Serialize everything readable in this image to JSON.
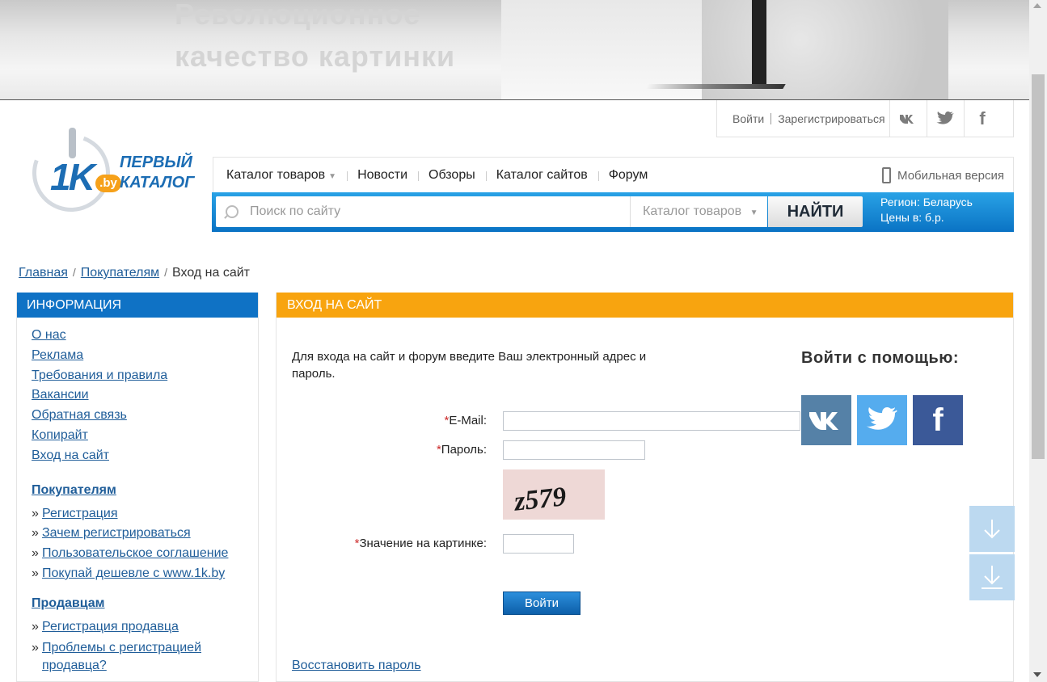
{
  "banner": {
    "headline_line1": "Революционное",
    "headline_line2": "качество картинки"
  },
  "userbar": {
    "login": "Войти",
    "register": "Зарегистрироваться",
    "social": [
      "vk-icon",
      "twitter-icon",
      "facebook-icon"
    ]
  },
  "logo": {
    "number": "1K",
    "domain": ".by",
    "word1": "ПЕРВЫЙ",
    "word2": "КАТАЛОГ"
  },
  "nav": {
    "items": [
      "Каталог товаров",
      "Новости",
      "Обзоры",
      "Каталог сайтов",
      "Форум"
    ],
    "mobile": "Мобильная версия"
  },
  "search": {
    "placeholder": "Поиск по сайту",
    "scope": "Каталог товаров",
    "button": "НАЙТИ",
    "region": "Регион: Беларусь",
    "currency": "Цены в: б.р."
  },
  "breadcrumb": {
    "home": "Главная",
    "section": "Покупателям",
    "current": "Вход на сайт"
  },
  "sidebar": {
    "header": "ИНФОРМАЦИЯ",
    "info_links": [
      "О нас",
      "Реклама",
      "Требования и правила",
      "Вакансии",
      "Обратная связь",
      "Копирайт",
      "Вход на сайт"
    ],
    "buyers_title": "Покупателям",
    "buyers_links": [
      "Регистрация",
      "Зачем регистрироваться",
      "Пользовательское соглашение",
      "Покупай дешевле с www.1k.by"
    ],
    "sellers_title": "Продавцам",
    "sellers_links": [
      "Регистрация продавца",
      "Проблемы с регистрацией продавца?"
    ]
  },
  "login": {
    "header": "ВХОД НА САЙТ",
    "intro": "Для входа на сайт и форум введите Ваш электронный адрес и пароль.",
    "email_label": "E-Mail:",
    "password_label": "Пароль:",
    "captcha_text": "z579",
    "captcha_label": "Значение на картинке:",
    "required_mark": "*",
    "submit": "Войти",
    "recover": "Восстановить пароль",
    "social_title": "Войти с помощью:"
  },
  "colors": {
    "blue": "#0f72c5",
    "orange": "#f8a40f",
    "link": "#1f5d99"
  }
}
